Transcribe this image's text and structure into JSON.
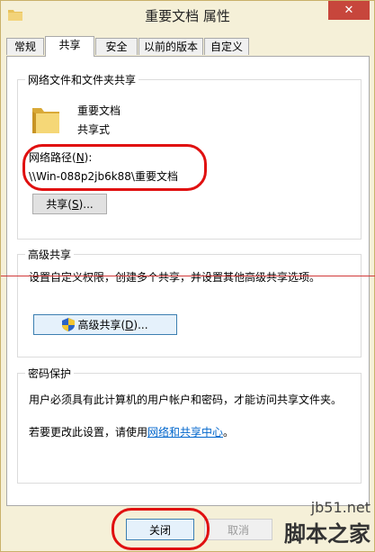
{
  "window": {
    "title": "重要文档 属性",
    "close_glyph": "✕"
  },
  "tabs": [
    {
      "label": "常规"
    },
    {
      "label": "共享"
    },
    {
      "label": "安全"
    },
    {
      "label": "以前的版本"
    },
    {
      "label": "自定义"
    }
  ],
  "network_sharing": {
    "group_title": "网络文件和文件夹共享",
    "folder_name": "重要文档",
    "share_status": "共享式",
    "path_label_prefix": "网络路径(",
    "path_label_key": "N",
    "path_label_suffix": "):",
    "path_value": "\\\\Win-088p2jb6k88\\重要文档",
    "share_button_prefix": "共享(",
    "share_button_key": "S",
    "share_button_suffix": ")..."
  },
  "advanced_sharing": {
    "group_title": "高级共享",
    "description": "设置自定义权限，创建多个共享，并设置其他高级共享选项。",
    "button_prefix": "高级共享(",
    "button_key": "D",
    "button_suffix": ")..."
  },
  "password_protection": {
    "group_title": "密码保护",
    "description": "用户必须具有此计算机的用户帐户和密码，才能访问共享文件夹。",
    "change_prefix": "若要更改此设置，请使用",
    "link_text": "网络和共享中心",
    "change_suffix": "。"
  },
  "footer": {
    "close_label": "关闭",
    "cancel_label": "取消"
  },
  "watermark": {
    "site": "jb51.net",
    "brand": "脚本之家"
  },
  "colors": {
    "annotation_red": "#e01010",
    "link_blue": "#0066cc",
    "title_close_red": "#c7463c"
  }
}
